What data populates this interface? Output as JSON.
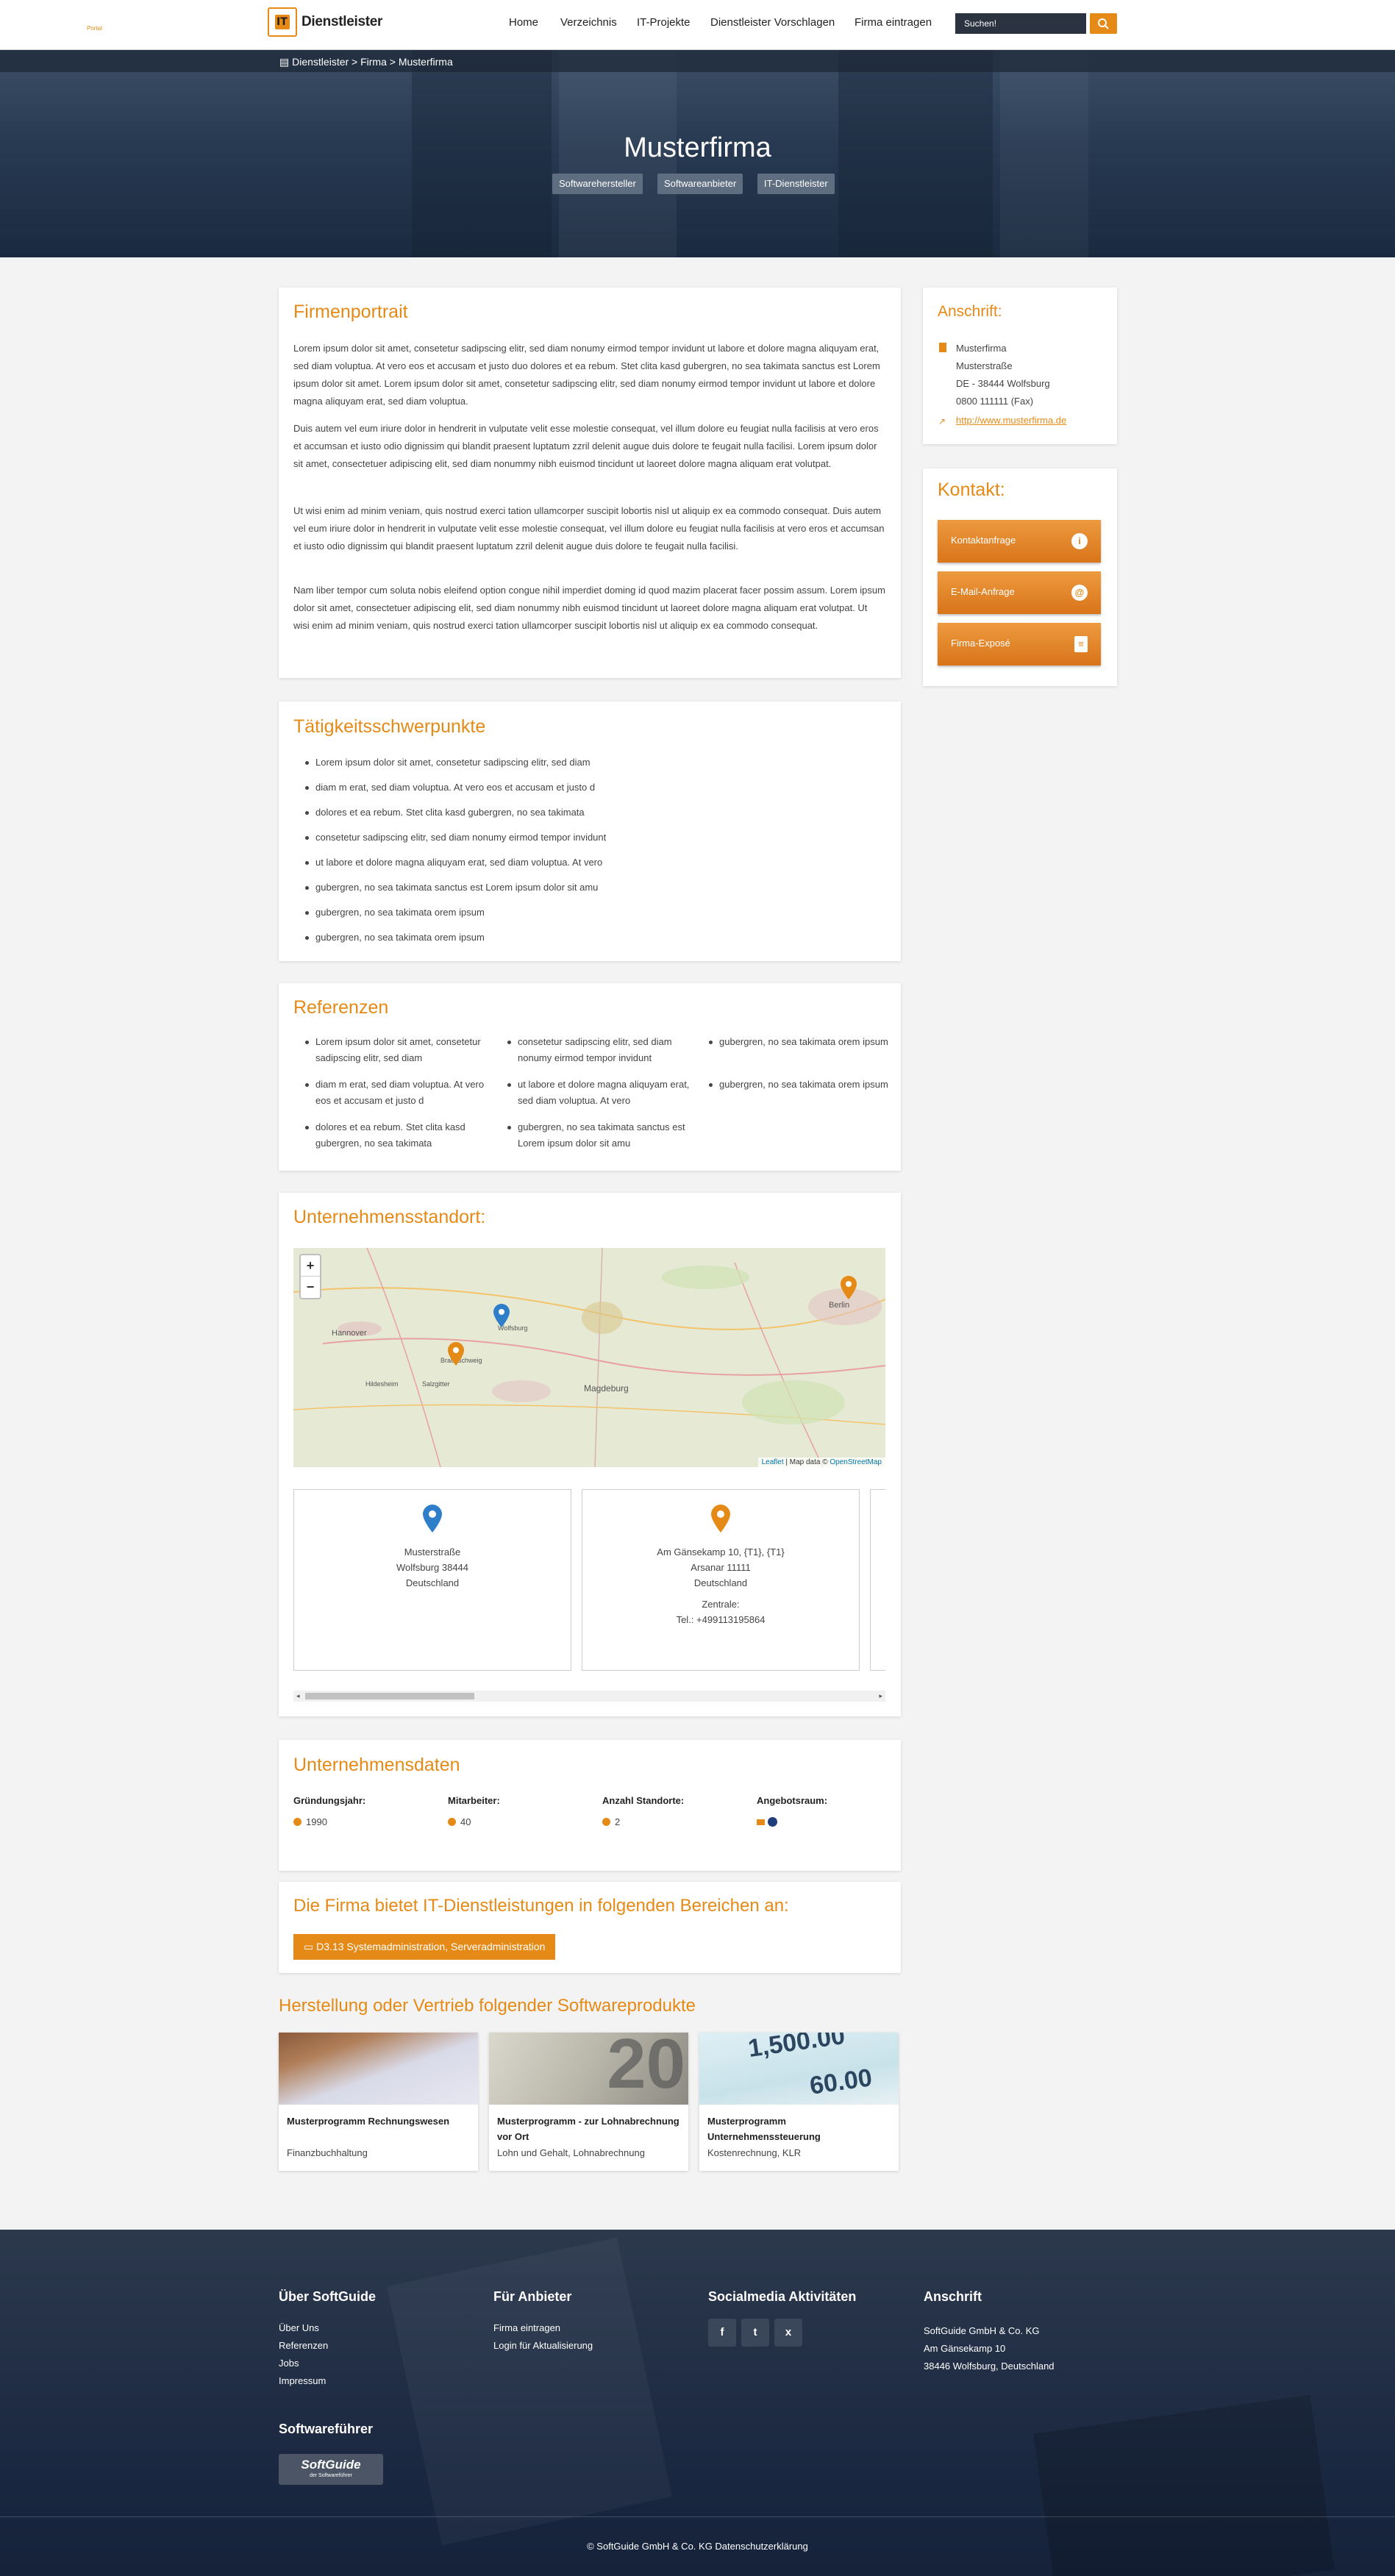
{
  "header": {
    "logo_text": "Dienstleister",
    "logo_sub": "Portal",
    "nav": [
      "Home",
      "Verzeichnis",
      "IT-Projekte",
      "Dienstleister Vorschlagen",
      "Firma eintragen"
    ],
    "search_placeholder": "Suchen!"
  },
  "breadcrumb": "Dienstleister > Firma > Musterfirma",
  "hero": {
    "title": "Musterfirma",
    "tags": [
      "Softwarehersteller",
      "Softwareanbieter",
      "IT-Dienstleister"
    ]
  },
  "firmenportrait": {
    "title": "Firmenportrait",
    "paragraphs": [
      "Lorem ipsum dolor sit amet, consetetur sadipscing elitr, sed diam nonumy eirmod tempor invidunt ut labore et dolore magna aliquyam erat, sed diam voluptua. At vero eos et accusam et justo duo dolores et ea rebum. Stet clita kasd gubergren, no sea takimata sanctus est Lorem ipsum dolor sit amet. Lorem ipsum dolor sit amet, consetetur sadipscing elitr, sed diam nonumy eirmod tempor invidunt ut labore et dolore magna aliquyam erat, sed diam voluptua.",
      "Duis autem vel eum iriure dolor in hendrerit in vulputate velit esse molestie consequat, vel illum dolore eu feugiat nulla facilisis at vero eros et accumsan et iusto odio dignissim qui blandit praesent luptatum zzril delenit augue duis dolore te feugait nulla facilisi. Lorem ipsum dolor sit amet, consectetuer adipiscing elit, sed diam nonummy nibh euismod tincidunt ut laoreet dolore magna aliquam erat volutpat.",
      "Ut wisi enim ad minim veniam, quis nostrud exerci tation ullamcorper suscipit lobortis nisl ut aliquip ex ea commodo consequat. Duis autem vel eum iriure dolor in hendrerit in vulputate velit esse molestie consequat, vel illum dolore eu feugiat nulla facilisis at vero eros et accumsan et iusto odio dignissim qui blandit praesent luptatum zzril delenit augue duis dolore te feugait nulla facilisi.",
      "Nam liber tempor cum soluta nobis eleifend option congue nihil imperdiet doming id quod mazim placerat facer possim assum. Lorem ipsum dolor sit amet, consectetuer adipiscing elit, sed diam nonummy nibh euismod tincidunt ut laoreet dolore magna aliquam erat volutpat. Ut wisi enim ad minim veniam, quis nostrud exerci tation ullamcorper suscipit lobortis nisl ut aliquip ex ea commodo consequat."
    ]
  },
  "anschrift": {
    "title": "Anschrift:",
    "lines": [
      "Musterfirma",
      "Musterstraße",
      "DE - 38444 Wolfsburg",
      "0800 111111 (Fax)"
    ],
    "website": "http://www.musterfirma.de"
  },
  "kontakt": {
    "title": "Kontakt:",
    "buttons": [
      "Kontaktanfrage",
      "E-Mail-Anfrage",
      "Firma-Exposé"
    ]
  },
  "taetigkeit": {
    "title": "Tätigkeitsschwerpunkte",
    "items": [
      "Lorem ipsum dolor sit amet, consetetur sadipscing elitr, sed diam",
      "diam m erat, sed diam voluptua. At vero eos et accusam et justo d",
      "dolores et ea rebum. Stet clita kasd gubergren, no sea takimata",
      "consetetur sadipscing elitr, sed diam nonumy eirmod tempor invidunt",
      "ut labore et dolore magna aliquyam erat, sed diam voluptua. At vero",
      "gubergren, no sea takimata sanctus est Lorem ipsum dolor sit amu",
      "gubergren, no sea takimata orem ipsum",
      "gubergren, no sea takimata orem ipsum"
    ]
  },
  "referenzen": {
    "title": "Referenzen",
    "columns": [
      [
        "Lorem ipsum dolor sit amet, consetetur sadipscing elitr, sed diam",
        "diam m erat, sed diam voluptua. At vero eos et accusam et justo d",
        "dolores et ea rebum. Stet clita kasd gubergren, no sea takimata"
      ],
      [
        "consetetur sadipscing elitr, sed diam nonumy eirmod tempor invidunt",
        "ut labore et dolore magna aliquyam erat, sed diam voluptua. At vero",
        "gubergren, no sea takimata sanctus est Lorem ipsum dolor sit amu"
      ],
      [
        "gubergren, no sea takimata orem ipsum",
        "gubergren, no sea takimata orem ipsum"
      ]
    ]
  },
  "standort": {
    "title": "Unternehmensstandort:",
    "zoom_in": "+",
    "zoom_out": "−",
    "map_labels": [
      "Hannover",
      "Wolfsburg",
      "Braunschweig",
      "Magdeburg",
      "Berlin",
      "Hildesheim",
      "Salzgitter"
    ],
    "attribution_leaflet": "Leaflet",
    "attribution_text": " | Map data © ",
    "attribution_osm": "OpenStreetMap",
    "locations": [
      {
        "lines": [
          "Musterstraße",
          "Wolfsburg 38444",
          "Deutschland"
        ],
        "extra": []
      },
      {
        "lines": [
          "Am Gänsekamp 10, {T1}, {T1}",
          "Arsanar 11111",
          "Deutschland"
        ],
        "extra": [
          "Zentrale:",
          "Tel.: +499113195864"
        ]
      }
    ]
  },
  "unternehmensdaten": {
    "title": "Unternehmensdaten",
    "fields": [
      {
        "label": "Gründungsjahr:",
        "value": "1990"
      },
      {
        "label": "Mitarbeiter:",
        "value": "40"
      },
      {
        "label": "Anzahl Standorte:",
        "value": "2"
      },
      {
        "label": "Angebotsraum:",
        "value": ""
      }
    ]
  },
  "bereiche": {
    "title": "Die Firma bietet IT-Dienstleistungen in folgenden Bereichen an:",
    "button": "D3.13 Systemadministration, Serveradministration"
  },
  "produkte": {
    "title": "Herstellung oder Vertrieb folgender Softwareprodukte",
    "items": [
      {
        "name": "Musterprogramm Rechnungswesen",
        "sub": "Finanzbuchhaltung"
      },
      {
        "name": "Musterprogramm - zur Lohnabrechnung vor Ort",
        "sub": "Lohn und Gehalt, Lohnabrechnung"
      },
      {
        "name": "Musterprogramm Unternehmenssteuerung",
        "sub": "Kostenrechnung, KLR"
      }
    ],
    "image_texts": [
      "20",
      "1,500.00",
      "60.00"
    ]
  },
  "footer": {
    "about_title": "Über SoftGuide",
    "about_links": [
      "Über Uns",
      "Referenzen",
      "Jobs",
      "Impressum"
    ],
    "provider_title": "Für Anbieter",
    "provider_links": [
      "Firma eintragen",
      "Login für Aktualisierung"
    ],
    "social_title": "Socialmedia Aktivitäten",
    "social_icons": [
      "f",
      "t",
      "x"
    ],
    "address_title": "Anschrift",
    "address_lines": [
      "SoftGuide GmbH & Co. KG",
      "Am Gänsekamp 10",
      "38446 Wolfsburg, Deutschland"
    ],
    "guide_title": "Softwareführer",
    "guide_logo": "SoftGuide",
    "guide_logo_sub": "der Softwareführer",
    "copyright": "© SoftGuide GmbH & Co. KG Datenschutzerklärung"
  },
  "colors": {
    "accent": "#e58a16",
    "dark": "#1c2a40"
  }
}
